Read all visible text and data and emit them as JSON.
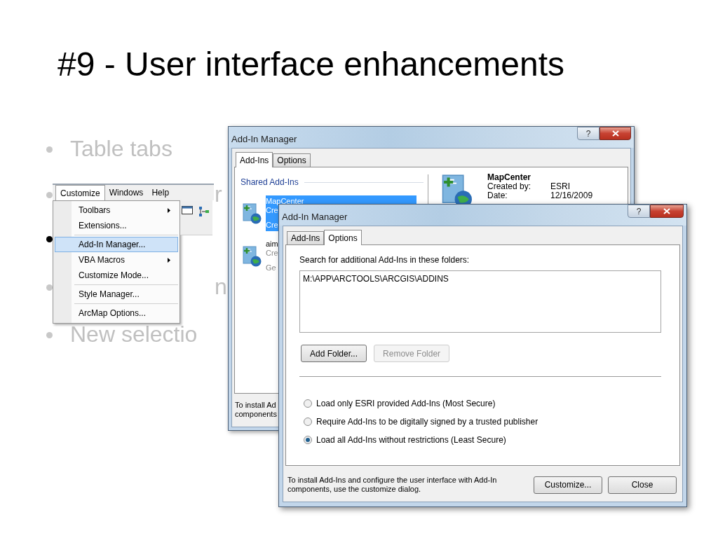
{
  "slide_title": "#9 - User interface enhancements",
  "bullets": [
    {
      "text": "Table tabs",
      "highlighted": false
    },
    {
      "text": "r",
      "highlighted": false
    },
    {
      "highlighted": true
    },
    {
      "text": "n",
      "highlighted": false
    },
    {
      "text": "New selectio",
      "highlighted": false
    }
  ],
  "menu": {
    "menubar": [
      {
        "label": "Customize",
        "selected": true
      },
      {
        "label": "Windows",
        "selected": false
      },
      {
        "label": "Help",
        "selected": false
      }
    ],
    "items": [
      {
        "kind": "item",
        "label": "Toolbars",
        "submenu": true,
        "selected": false
      },
      {
        "kind": "item",
        "label": "Extensions...",
        "submenu": false,
        "selected": false
      },
      {
        "kind": "separator"
      },
      {
        "kind": "item",
        "label": "Add-In Manager...",
        "submenu": false,
        "selected": true
      },
      {
        "kind": "item",
        "label": "VBA Macros",
        "submenu": true,
        "selected": false
      },
      {
        "kind": "item",
        "label": "Customize Mode...",
        "submenu": false,
        "selected": false
      },
      {
        "kind": "separator"
      },
      {
        "kind": "item",
        "label": "Style Manager...",
        "submenu": false,
        "selected": false
      },
      {
        "kind": "separator"
      },
      {
        "kind": "item",
        "label": "ArcMap Options...",
        "submenu": false,
        "selected": false
      }
    ]
  },
  "back_dialog": {
    "title": "Add-In Manager",
    "help_button": "?",
    "tabs": [
      {
        "label": "Add-Ins",
        "selected": true
      },
      {
        "label": "Options",
        "selected": false
      }
    ],
    "group_heading": "Shared Add-Ins",
    "addins": [
      {
        "lines": [
          "MapCenter",
          "Cre",
          "Cre"
        ],
        "selected": true
      },
      {
        "lines": [
          "aim",
          "Cre",
          "Ge"
        ],
        "selected": false
      }
    ],
    "details": {
      "name": "MapCenter",
      "rows": [
        {
          "label": "Created by:",
          "value": "ESRI"
        },
        {
          "label": "Date:",
          "value": "12/16/2009"
        }
      ]
    },
    "footer_lines": [
      "To install Ad",
      "components"
    ]
  },
  "front_dialog": {
    "title": "Add-In Manager",
    "help_button": "?",
    "tabs": [
      {
        "label": "Add-Ins",
        "selected": false
      },
      {
        "label": "Options",
        "selected": true
      }
    ],
    "folders_label": "Search for additional Add-Ins in these folders:",
    "folders": [
      "M:\\APP\\ARCTOOLS\\ARCGIS\\ADDINS"
    ],
    "folder_buttons": [
      {
        "label": "Add Folder...",
        "disabled": false
      },
      {
        "label": "Remove Folder",
        "disabled": true
      }
    ],
    "security_options": [
      {
        "label": "Load only ESRI provided Add-Ins (Most Secure)",
        "selected": false
      },
      {
        "label": "Require Add-Ins to be digitally signed by a trusted publisher",
        "selected": false
      },
      {
        "label": "Load all Add-Ins without restrictions (Least Secure)",
        "selected": true
      }
    ],
    "footer_text": "To install Add-Ins and configure the user interface with Add-In components, use the customize dialog.",
    "buttons": [
      "Customize...",
      "Close"
    ]
  }
}
